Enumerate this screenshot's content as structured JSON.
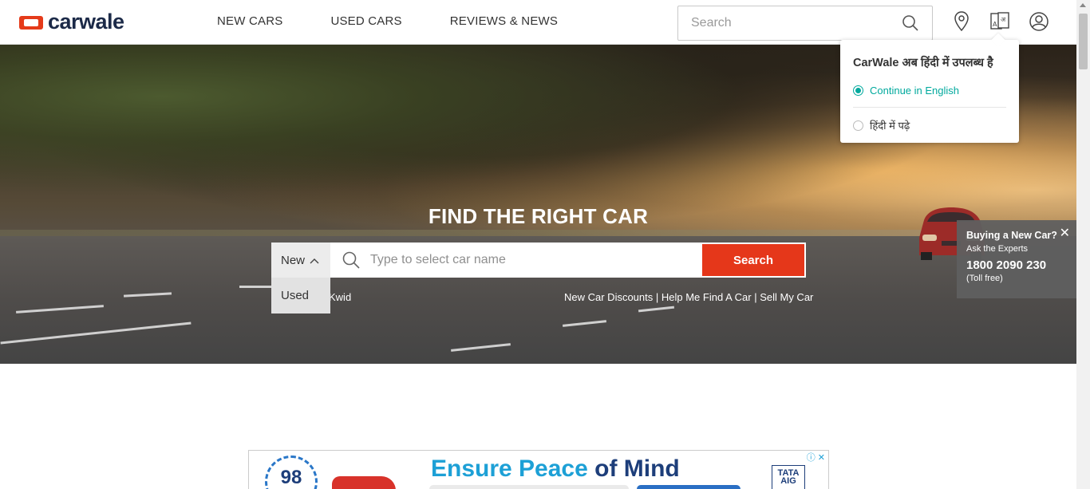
{
  "brand": {
    "name": "carwale",
    "accent": "#e5371a"
  },
  "nav": {
    "items": [
      "NEW CARS",
      "USED CARS",
      "REVIEWS & NEWS"
    ]
  },
  "header_search": {
    "placeholder": "Search",
    "icon": "search-icon"
  },
  "header_icons": [
    "location-pin-icon",
    "language-icon",
    "user-account-icon"
  ],
  "language_popup": {
    "title": "CarWale अब हिंदी में उपलब्ध है",
    "option_english": "Continue in English",
    "option_hindi": "हिंदी में पढ़े",
    "selected": "english"
  },
  "hero": {
    "title": "FIND THE RIGHT CAR",
    "type_select": {
      "selected": "New",
      "options": [
        "Used"
      ]
    },
    "search_placeholder": "Type to select car name",
    "search_button": "Search",
    "quick_left": "Kwid",
    "quick_links": [
      "New Car Discounts",
      "Help Me Find A Car",
      "Sell My Car"
    ],
    "quick_links_separator": " | "
  },
  "expert_box": {
    "title": "Buying a New Car?",
    "subtitle": "Ask the Experts",
    "phone": "1800 2090 230",
    "note": "(Toll free)",
    "close": "✕"
  },
  "ad": {
    "headline_light": "Ensure Peace ",
    "headline_dark": "of Mind",
    "badge": "98",
    "brand_line1": "TATA",
    "brand_line2": "AIG",
    "adchoices": "ⓘ ✕"
  }
}
